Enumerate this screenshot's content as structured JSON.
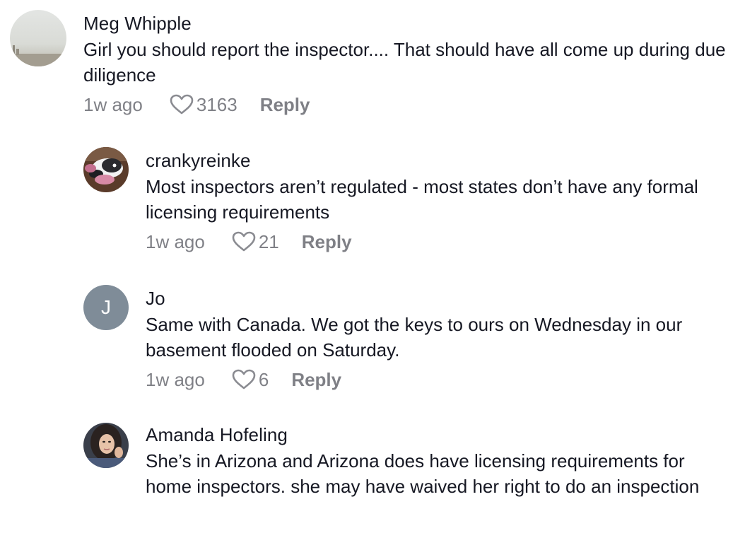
{
  "comments": [
    {
      "author": "Meg Whipple",
      "text": "Girl you should report the inspector.... That should have all come up during due diligence",
      "time": "1w ago",
      "likes": "3163",
      "reply_label": "Reply",
      "avatar_icon": "landscape-photo-avatar"
    },
    {
      "author": "crankyreinke",
      "text": "Most inspectors aren’t regulated - most states don’t have any formal licensing requirements",
      "time": "1w ago",
      "likes": "21",
      "reply_label": "Reply",
      "avatar_icon": "dog-photo-avatar"
    },
    {
      "author": "Jo",
      "text": "Same with Canada. We got the keys to ours on Wednesday in our basement flooded on Saturday.",
      "time": "1w ago",
      "likes": "6",
      "reply_label": "Reply",
      "avatar_initial": "J",
      "avatar_color": "#7f8c98"
    },
    {
      "author": "Amanda Hofeling",
      "text": "She’s in Arizona and Arizona does have licensing requirements for home inspectors. she may have waived her right to do an inspection",
      "avatar_icon": "person-photo-avatar"
    }
  ],
  "colors": {
    "text": "#161823",
    "muted": "#8a8b91"
  },
  "icons": {
    "like": "heart-outline-icon"
  }
}
